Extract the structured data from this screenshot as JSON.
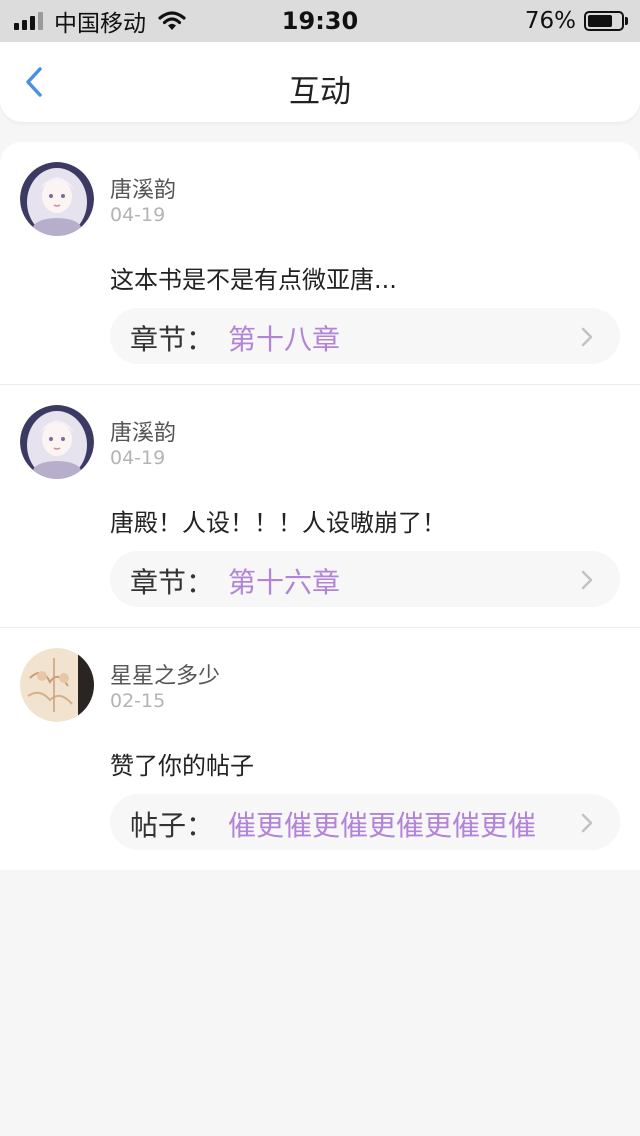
{
  "status_bar": {
    "carrier": "中国移动",
    "time": "19:30",
    "battery": "76%",
    "battery_level": 0.76,
    "signal_bars": 3,
    "signal_total": 4
  },
  "nav": {
    "title": "互动",
    "back_icon": "chevron-left-icon",
    "accent_color": "#4a90e2"
  },
  "items": [
    {
      "user": "唐溪韵",
      "date": "04-19",
      "content": "这本书是不是有点微亚唐...",
      "ref_label": "章节：",
      "ref_value": "第十八章"
    },
    {
      "user": "唐溪韵",
      "date": "04-19",
      "content": "唐殿！人设！！！人设嗷崩了！",
      "ref_label": "章节：",
      "ref_value": "第十六章"
    },
    {
      "user": "星星之多少",
      "date": "02-15",
      "content": "赞了你的帖子",
      "ref_label": "帖子：",
      "ref_value": "催更催更催更催更催更催"
    }
  ],
  "colors": {
    "link_purple": "#b184d8",
    "background": "#f6f6f6"
  }
}
